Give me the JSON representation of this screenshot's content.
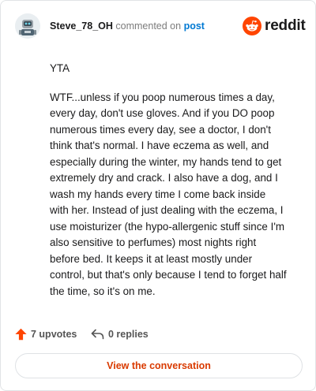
{
  "header": {
    "username": "Steve_78_OH",
    "action_text": " commented on ",
    "post_link": "post",
    "avatar_icon": "robot-avatar-icon",
    "brand_icon": "reddit-snoo-icon",
    "brand_name": "reddit"
  },
  "comment": {
    "paragraphs": [
      "YTA",
      "WTF...unless if you poop numerous times a day, every day, don't use gloves. And if you DO poop numerous times every day, see a doctor, I don't think that's normal. I have eczema as well, and especially during the winter, my hands tend to get extremely dry and crack. I also have a dog, and I wash my hands every time I come back inside with her. Instead of just dealing with the eczema, I use moisturizer (the hypo-allergenic stuff since I'm also sensitive to perfumes) most nights right before bed. It keeps it at least mostly under control, but that's only because I tend to forget half the time, so it's on me."
    ]
  },
  "actions": {
    "upvotes_label": "7 upvotes",
    "upvote_icon": "upvote-arrow-icon",
    "replies_label": "0 replies",
    "reply_icon": "reply-arrow-icon"
  },
  "cta": {
    "label": "View the conversation"
  },
  "colors": {
    "brand": "#ff4500",
    "link": "#0079d3",
    "cta_text": "#d93a00",
    "text": "#1a1a1b",
    "muted": "#7c7c7c"
  }
}
